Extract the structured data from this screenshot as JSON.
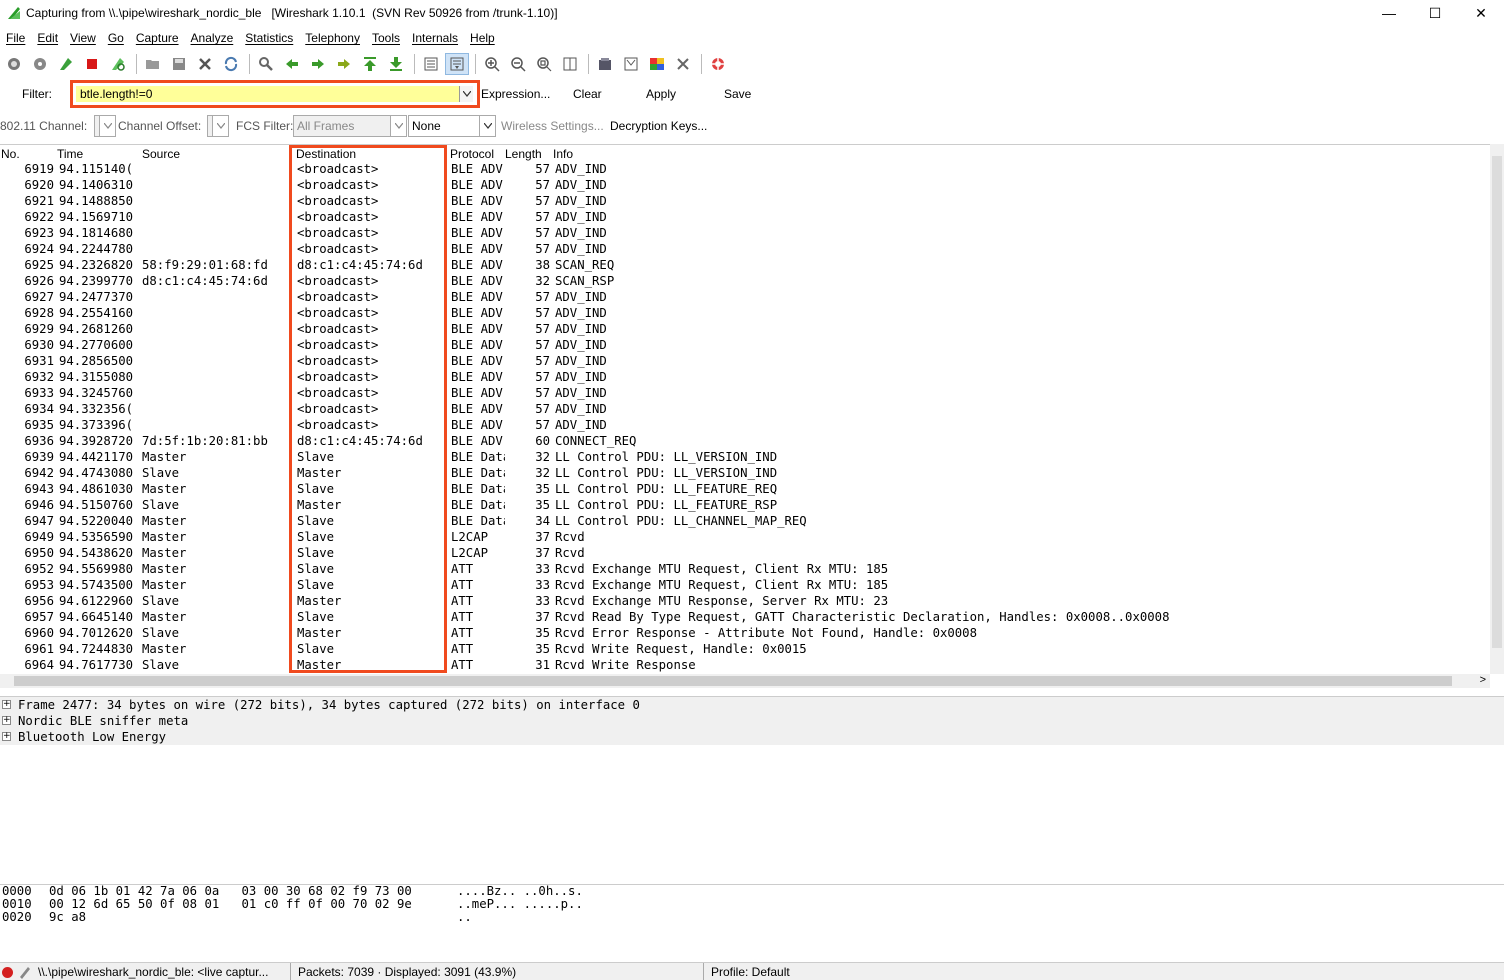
{
  "window": {
    "title": "Capturing from \\\\.\\pipe\\wireshark_nordic_ble   [Wireshark 1.10.1  (SVN Rev 50926 from /trunk-1.10)]",
    "minimize": "—",
    "maximize": "☐",
    "close": "✕"
  },
  "menu": [
    "File",
    "Edit",
    "View",
    "Go",
    "Capture",
    "Analyze",
    "Statistics",
    "Telephony",
    "Tools",
    "Internals",
    "Help"
  ],
  "filter": {
    "label": "Filter:",
    "value": "btle.length!=0",
    "expression": "Expression...",
    "clear": "Clear",
    "apply": "Apply",
    "save": "Save"
  },
  "wireless": {
    "channel_label": "802.11 Channel:",
    "offset_label": "Channel Offset:",
    "fcs_label": "FCS Filter:",
    "fcs_value": "All Frames",
    "decrypt_value": "None",
    "settings": "Wireless Settings...",
    "keys": "Decryption Keys..."
  },
  "columns": {
    "no": "No.",
    "time": "Time",
    "source": "Source",
    "destination": "Destination",
    "protocol": "Protocol",
    "length": "Length",
    "info": "Info"
  },
  "packets": [
    {
      "no": "6919",
      "time": "94.115140(",
      "src": "",
      "dst": "<broadcast>",
      "proto": "BLE ADV",
      "len": "57",
      "info": "ADV_IND"
    },
    {
      "no": "6920",
      "time": "94.1406310",
      "src": "",
      "dst": "<broadcast>",
      "proto": "BLE ADV",
      "len": "57",
      "info": "ADV_IND"
    },
    {
      "no": "6921",
      "time": "94.1488850",
      "src": "",
      "dst": "<broadcast>",
      "proto": "BLE ADV",
      "len": "57",
      "info": "ADV_IND"
    },
    {
      "no": "6922",
      "time": "94.1569710",
      "src": "",
      "dst": "<broadcast>",
      "proto": "BLE ADV",
      "len": "57",
      "info": "ADV_IND"
    },
    {
      "no": "6923",
      "time": "94.1814680",
      "src": "",
      "dst": "<broadcast>",
      "proto": "BLE ADV",
      "len": "57",
      "info": "ADV_IND"
    },
    {
      "no": "6924",
      "time": "94.2244780",
      "src": "",
      "dst": "<broadcast>",
      "proto": "BLE ADV",
      "len": "57",
      "info": "ADV_IND"
    },
    {
      "no": "6925",
      "time": "94.2326820",
      "src": "58:f9:29:01:68:fd",
      "dst": "d8:c1:c4:45:74:6d",
      "proto": "BLE ADV",
      "len": "38",
      "info": "SCAN_REQ"
    },
    {
      "no": "6926",
      "time": "94.2399770",
      "src": "d8:c1:c4:45:74:6d",
      "dst": "<broadcast>",
      "proto": "BLE ADV",
      "len": "32",
      "info": "SCAN_RSP"
    },
    {
      "no": "6927",
      "time": "94.2477370",
      "src": "",
      "dst": "<broadcast>",
      "proto": "BLE ADV",
      "len": "57",
      "info": "ADV_IND"
    },
    {
      "no": "6928",
      "time": "94.2554160",
      "src": "",
      "dst": "<broadcast>",
      "proto": "BLE ADV",
      "len": "57",
      "info": "ADV_IND"
    },
    {
      "no": "6929",
      "time": "94.2681260",
      "src": "",
      "dst": "<broadcast>",
      "proto": "BLE ADV",
      "len": "57",
      "info": "ADV_IND"
    },
    {
      "no": "6930",
      "time": "94.2770600",
      "src": "",
      "dst": "<broadcast>",
      "proto": "BLE ADV",
      "len": "57",
      "info": "ADV_IND"
    },
    {
      "no": "6931",
      "time": "94.2856500",
      "src": "",
      "dst": "<broadcast>",
      "proto": "BLE ADV",
      "len": "57",
      "info": "ADV_IND"
    },
    {
      "no": "6932",
      "time": "94.3155080",
      "src": "",
      "dst": "<broadcast>",
      "proto": "BLE ADV",
      "len": "57",
      "info": "ADV_IND"
    },
    {
      "no": "6933",
      "time": "94.3245760",
      "src": "",
      "dst": "<broadcast>",
      "proto": "BLE ADV",
      "len": "57",
      "info": "ADV_IND"
    },
    {
      "no": "6934",
      "time": "94.332356(",
      "src": "",
      "dst": "<broadcast>",
      "proto": "BLE ADV",
      "len": "57",
      "info": "ADV_IND"
    },
    {
      "no": "6935",
      "time": "94.373396(",
      "src": "",
      "dst": "<broadcast>",
      "proto": "BLE ADV",
      "len": "57",
      "info": "ADV_IND"
    },
    {
      "no": "6936",
      "time": "94.3928720",
      "src": "7d:5f:1b:20:81:bb",
      "dst": "d8:c1:c4:45:74:6d",
      "proto": "BLE ADV",
      "len": "60",
      "info": "CONNECT_REQ"
    },
    {
      "no": "6939",
      "time": "94.4421170",
      "src": "Master",
      "dst": "Slave",
      "proto": "BLE Data",
      "len": "32",
      "info": "LL Control PDU: LL_VERSION_IND"
    },
    {
      "no": "6942",
      "time": "94.4743080",
      "src": "Slave",
      "dst": "Master",
      "proto": "BLE Data",
      "len": "32",
      "info": "LL Control PDU: LL_VERSION_IND"
    },
    {
      "no": "6943",
      "time": "94.4861030",
      "src": "Master",
      "dst": "Slave",
      "proto": "BLE Data",
      "len": "35",
      "info": "LL Control PDU: LL_FEATURE_REQ"
    },
    {
      "no": "6946",
      "time": "94.5150760",
      "src": "Slave",
      "dst": "Master",
      "proto": "BLE Data",
      "len": "35",
      "info": "LL Control PDU: LL_FEATURE_RSP"
    },
    {
      "no": "6947",
      "time": "94.5220040",
      "src": "Master",
      "dst": "Slave",
      "proto": "BLE Data",
      "len": "34",
      "info": "LL Control PDU: LL_CHANNEL_MAP_REQ"
    },
    {
      "no": "6949",
      "time": "94.5356590",
      "src": "Master",
      "dst": "Slave",
      "proto": "L2CAP",
      "len": "37",
      "info": "Rcvd"
    },
    {
      "no": "6950",
      "time": "94.5438620",
      "src": "Master",
      "dst": "Slave",
      "proto": "L2CAP",
      "len": "37",
      "info": "Rcvd"
    },
    {
      "no": "6952",
      "time": "94.5569980",
      "src": "Master",
      "dst": "Slave",
      "proto": "ATT",
      "len": "33",
      "info": "Rcvd Exchange MTU Request, Client Rx MTU: 185"
    },
    {
      "no": "6953",
      "time": "94.5743500",
      "src": "Master",
      "dst": "Slave",
      "proto": "ATT",
      "len": "33",
      "info": "Rcvd Exchange MTU Request, Client Rx MTU: 185"
    },
    {
      "no": "6956",
      "time": "94.6122960",
      "src": "Slave",
      "dst": "Master",
      "proto": "ATT",
      "len": "33",
      "info": "Rcvd Exchange MTU Response, Server Rx MTU: 23"
    },
    {
      "no": "6957",
      "time": "94.6645140",
      "src": "Master",
      "dst": "Slave",
      "proto": "ATT",
      "len": "37",
      "info": "Rcvd Read By Type Request, GATT Characteristic Declaration, Handles: 0x0008..0x0008"
    },
    {
      "no": "6960",
      "time": "94.7012620",
      "src": "Slave",
      "dst": "Master",
      "proto": "ATT",
      "len": "35",
      "info": "Rcvd Error Response - Attribute Not Found, Handle: 0x0008"
    },
    {
      "no": "6961",
      "time": "94.7244830",
      "src": "Master",
      "dst": "Slave",
      "proto": "ATT",
      "len": "35",
      "info": "Rcvd Write Request, Handle: 0x0015"
    },
    {
      "no": "6964",
      "time": "94.7617730",
      "src": "Slave",
      "dst": "Master",
      "proto": "ATT",
      "len": "31",
      "info": "Rcvd Write Response"
    }
  ],
  "details": [
    {
      "expand": "+",
      "label": "Frame 2477: 34 bytes on wire (272 bits), 34 bytes captured (272 bits) on interface 0"
    },
    {
      "expand": "+",
      "label": "Nordic BLE sniffer meta"
    },
    {
      "expand": "+",
      "label": "Bluetooth Low Energy"
    }
  ],
  "bytes": [
    {
      "offset": "0000",
      "hex": "0d 06 1b 01 42 7a 06 0a   03 00 30 68 02 f9 73 00",
      "ascii": "....Bz.. ..0h..s."
    },
    {
      "offset": "0010",
      "hex": "00 12 6d 65 50 0f 08 01   01 c0 ff 0f 00 70 02 9e",
      "ascii": "..meP... .....p.."
    },
    {
      "offset": "0020",
      "hex": "9c a8",
      "ascii": ".."
    }
  ],
  "status": {
    "file": "\\\\.\\pipe\\wireshark_nordic_ble: <live captur...",
    "packets": "Packets: 7039 · Displayed: 3091 (43.9%)",
    "profile": "Profile: Default"
  },
  "colors": {
    "highlight": "#f04a1e",
    "filter_bg": "#ffff99",
    "capture_running": "#d42020"
  }
}
